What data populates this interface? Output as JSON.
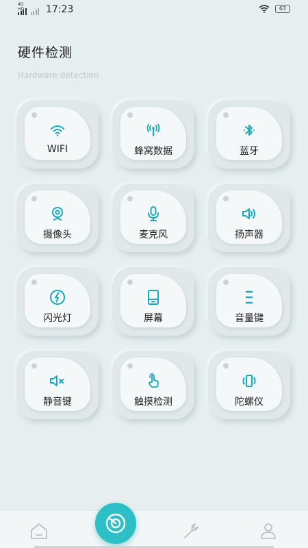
{
  "status_bar": {
    "network": "4G HD",
    "time": "17:23",
    "battery": "63"
  },
  "header": {
    "title": "硬件检测",
    "subtitle": "Hardware detection"
  },
  "tiles": [
    {
      "label": "WIFI",
      "icon": "wifi-icon"
    },
    {
      "label": "蜂窝数据",
      "icon": "cellular-data-icon"
    },
    {
      "label": "蓝牙",
      "icon": "bluetooth-icon"
    },
    {
      "label": "摄像头",
      "icon": "camera-icon"
    },
    {
      "label": "麦克风",
      "icon": "microphone-icon"
    },
    {
      "label": "扬声器",
      "icon": "speaker-icon"
    },
    {
      "label": "闪光灯",
      "icon": "flashlight-icon"
    },
    {
      "label": "屏幕",
      "icon": "screen-icon"
    },
    {
      "label": "音量键",
      "icon": "volume-keys-icon"
    },
    {
      "label": "静音键",
      "icon": "mute-key-icon"
    },
    {
      "label": "触摸检测",
      "icon": "touch-icon"
    },
    {
      "label": "陀螺仪",
      "icon": "gyroscope-icon"
    }
  ],
  "tab_bar": {
    "tabs": [
      "home-icon",
      "detect-icon",
      "tools-icon",
      "profile-icon"
    ]
  },
  "colors": {
    "accent": "#2cc0c6",
    "icon": "#17a9c0",
    "background": "#e6eef0"
  }
}
